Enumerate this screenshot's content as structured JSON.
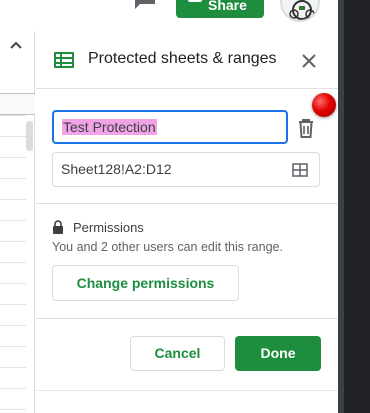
{
  "header": {
    "share_label": "Share",
    "icons": {
      "comment": "comment-icon",
      "share": "people-icon",
      "avatar": "avatar"
    }
  },
  "panel": {
    "title": "Protected sheets & ranges",
    "description_value": "Test Protection",
    "range_value": "Sheet128!A2:D12",
    "permissions_heading": "Permissions",
    "permissions_text": "You and 2 other users can edit this range.",
    "change_permissions_label": "Change permissions",
    "cancel_label": "Cancel",
    "done_label": "Done",
    "icons": {
      "header": "sheets-icon",
      "close": "close-icon",
      "delete": "trash-icon",
      "range_select": "grid-select-icon",
      "permissions": "lock-icon"
    }
  },
  "colors": {
    "accent_green": "#1e8e3e",
    "focus_blue": "#1a73e8",
    "text_highlight": "#f2a3e8",
    "cursor_dot": "#e00000"
  }
}
